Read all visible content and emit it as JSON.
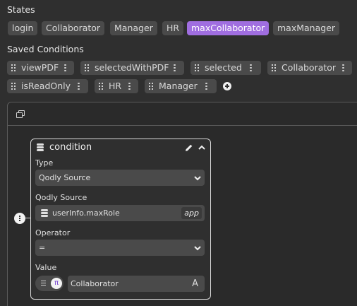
{
  "states": {
    "title": "States",
    "items": [
      "login",
      "Collaborator",
      "Manager",
      "HR",
      "maxCollaborator",
      "maxManager"
    ],
    "active": "maxCollaborator"
  },
  "saved_conditions": {
    "title": "Saved Conditions",
    "items": [
      "viewPDF",
      "selectedWithPDF",
      "selected",
      "Collaborator",
      "isReadOnly",
      "HR",
      "Manager"
    ]
  },
  "condition_card": {
    "title": "condition",
    "type_label": "Type",
    "type_value": "Qodly Source",
    "source_label": "Qodly Source",
    "source_value": "userInfo.maxRole",
    "source_scope": "app",
    "operator_label": "Operator",
    "operator_value": "=",
    "value_label": "Value",
    "value_text": "Collaborator",
    "value_type_glyph": "A",
    "value_mode_glyph": "π"
  },
  "colors": {
    "background": "#2f2f2f",
    "chip": "#4a4a4a",
    "accent": "#a06ee0"
  }
}
